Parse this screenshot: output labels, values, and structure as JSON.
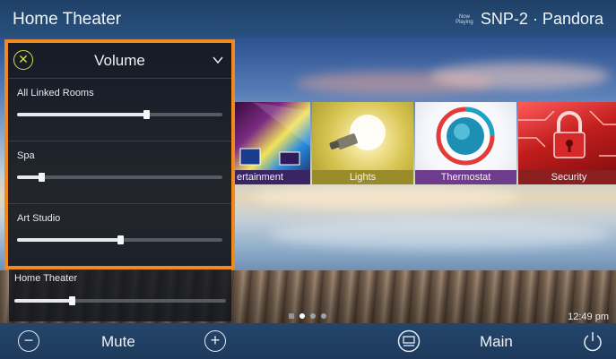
{
  "header": {
    "title": "Home Theater",
    "now_playing_tag": "Now Playing",
    "source": "SNP-2 · Pandora"
  },
  "tiles": [
    {
      "label": "ertainment",
      "icon": "entertainment-icon"
    },
    {
      "label": "Lights",
      "icon": "light-bulb-icon"
    },
    {
      "label": "Thermostat",
      "icon": "thermostat-icon"
    },
    {
      "label": "Security",
      "icon": "padlock-icon"
    }
  ],
  "volume_panel": {
    "title": "Volume",
    "rooms": [
      {
        "name": "All Linked Rooms",
        "level": 0.63
      },
      {
        "name": "Spa",
        "level": 0.12
      },
      {
        "name": "Art Studio",
        "level": 0.5
      }
    ]
  },
  "home_theater_row": {
    "name": "Home Theater",
    "level": 0.27
  },
  "pager": {
    "pages": 4,
    "active": 2
  },
  "clock": "12:49 pm",
  "bottom_bar": {
    "mute_label": "Mute",
    "main_label": "Main"
  },
  "colors": {
    "accent_orange": "#f18a1d",
    "header_blue": "#24456b",
    "close_yellow": "#d8dc4a"
  }
}
